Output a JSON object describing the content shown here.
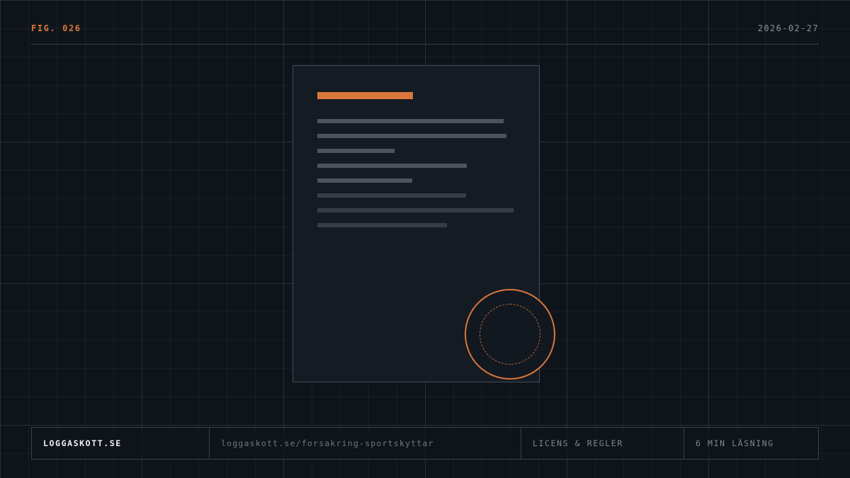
{
  "header": {
    "figure_label": "FIG. 026",
    "date": "2026-02-27"
  },
  "footer": {
    "site": "LOGGASKOTT.SE",
    "url": "loggaskott.se/forsakring-sportskyttar",
    "category": "LICENS & REGLER",
    "read_time": "6 MIN LÄSNING"
  },
  "colors": {
    "accent": "#d9773b",
    "background": "#0f141b",
    "document": "#151b22"
  },
  "illustration": {
    "document_icon": "document-icon",
    "stamp_icon": "seal-stamp-icon"
  }
}
